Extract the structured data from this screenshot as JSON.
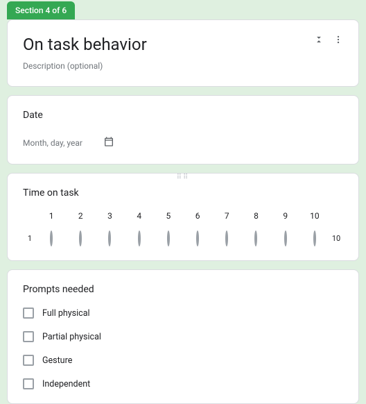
{
  "section_badge": "Section 4 of 6",
  "title_card": {
    "title": "On task behavior",
    "description": "Description (optional)"
  },
  "date_card": {
    "title": "Date",
    "placeholder": "Month, day, year"
  },
  "scale_card": {
    "title": "Time on task",
    "points": [
      "1",
      "2",
      "3",
      "4",
      "5",
      "6",
      "7",
      "8",
      "9",
      "10"
    ],
    "start_label": "1",
    "end_label": "10"
  },
  "prompts_card": {
    "title": "Prompts needed",
    "options": [
      "Full physical",
      "Partial physical",
      "Gesture",
      "Independent"
    ]
  }
}
